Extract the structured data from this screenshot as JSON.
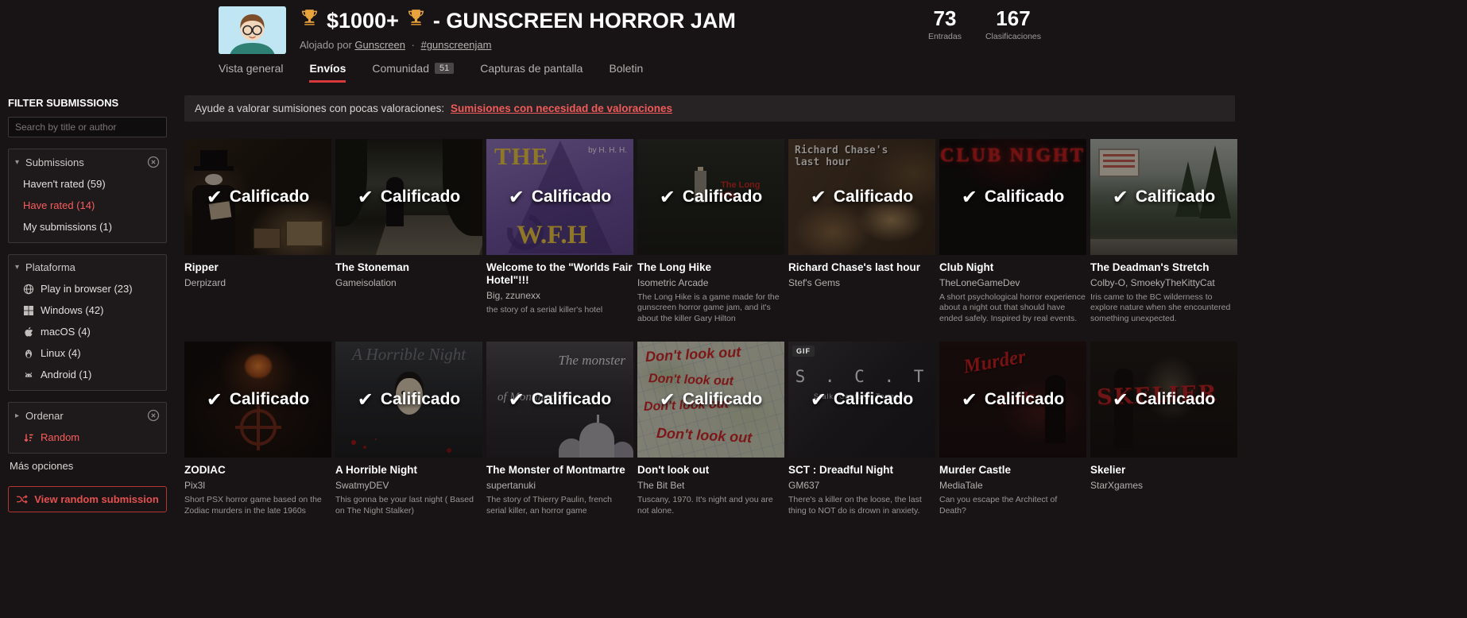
{
  "icons": {
    "check": "✔",
    "caret_down": "▾",
    "caret_right": "▸"
  },
  "header": {
    "prize": "$1000+",
    "title_rest": "- GUNSCREEN HORROR JAM",
    "hosted_prefix": "Alojado por",
    "host": "Gunscreen",
    "dot": "·",
    "hashtag": "#gunscreenjam",
    "stats": [
      {
        "value": "73",
        "label": "Entradas"
      },
      {
        "value": "167",
        "label": "Clasificaciones"
      }
    ]
  },
  "tabs": [
    {
      "label": "Vista general"
    },
    {
      "label": "Envíos",
      "active": true
    },
    {
      "label": "Comunidad",
      "badge": "51"
    },
    {
      "label": "Capturas de pantalla"
    },
    {
      "label": "Boletin"
    }
  ],
  "sidebar": {
    "title": "FILTER SUBMISSIONS",
    "search_placeholder": "Search by title or author",
    "sections": [
      {
        "label": "Submissions",
        "closable": true,
        "items": [
          {
            "label": "Haven't rated (59)"
          },
          {
            "label": "Have rated (14)",
            "active": true
          },
          {
            "label": "My submissions (1)"
          }
        ]
      },
      {
        "label": "Plataforma",
        "items": [
          {
            "icon": "globe",
            "label": "Play in browser (23)"
          },
          {
            "icon": "windows",
            "label": "Windows (42)"
          },
          {
            "icon": "apple",
            "label": "macOS (4)"
          },
          {
            "icon": "linux",
            "label": "Linux (4)"
          },
          {
            "icon": "android",
            "label": "Android (1)"
          }
        ]
      },
      {
        "label": "Ordenar",
        "closable": true,
        "items": [
          {
            "icon": "sort",
            "label": "Random",
            "active": true
          },
          {
            "label": "Más opciones"
          }
        ]
      }
    ],
    "random_button_label": "View random submission"
  },
  "notice": {
    "text": "Ayude a valorar sumisiones con pocas valoraciones:",
    "link_label": "Sumisiones con necesidad de valoraciones"
  },
  "rated_label": "Calificado",
  "gif_badge_label": "GIF",
  "cards": [
    {
      "title": "Ripper",
      "author": "Derpizard",
      "desc": "",
      "thumb": "ripper",
      "art": [
        {
          "cls": "rip-coat"
        },
        {
          "cls": "rip-face"
        },
        {
          "cls": "rip-hat"
        },
        {
          "cls": "rip-paper"
        },
        {
          "cls": "rip-panel"
        },
        {
          "cls": "rip-panel2"
        }
      ]
    },
    {
      "title": "The Stoneman",
      "author": "Gameisolation",
      "desc": "",
      "thumb": "stoneman",
      "art": [
        {
          "cls": "st-road"
        },
        {
          "cls": "st-tree-l"
        },
        {
          "cls": "st-tree-r"
        },
        {
          "cls": "st-fig"
        }
      ]
    },
    {
      "title": "Welcome to the \"Worlds Fair Hotel\"!!!",
      "author": "Big, zzunexx",
      "desc": "the story of a serial killer's hotel",
      "thumb": "wfh",
      "art": [
        {
          "cls": "wfh-tri"
        },
        {
          "cls": "wfh-swirl"
        },
        {
          "cls": "wfh-the",
          "text": "THE"
        },
        {
          "cls": "wfh-by",
          "text": "by H. H. H."
        },
        {
          "cls": "wfh-main",
          "text": "W.F.H"
        }
      ]
    },
    {
      "title": "The Long Hike",
      "author": "Isometric Arcade",
      "desc": "The Long Hike is a game made for the gunscreen horror game jam, and it's about the killer Gary Hilton",
      "thumb": "longhike",
      "art": [
        {
          "cls": "lh-fig"
        },
        {
          "cls": "lh-red",
          "text": "The Long Hike"
        }
      ]
    },
    {
      "title": "Richard Chase's last hour",
      "author": "Stef's Gems",
      "desc": "",
      "thumb": "richard",
      "art": [
        {
          "cls": "rc-text",
          "text": "Richard Chase's last hour"
        }
      ]
    },
    {
      "title": "Club Night",
      "author": "TheLoneGameDev",
      "desc": "A short psychological horror experience about a night out that should have ended safely. Inspired by real events.",
      "thumb": "clubnight",
      "art": [
        {
          "cls": "cn-text",
          "text": "CLUB NIGHT"
        }
      ]
    },
    {
      "title": "The Deadman's Stretch",
      "author": "Colby-O, SmoekyTheKittyCat",
      "desc": "Iris came to the BC wilderness to explore nature when she encountered something unexpected.",
      "thumb": "deadman",
      "art": [
        {
          "cls": "dm-tree1"
        },
        {
          "cls": "dm-tree2"
        },
        {
          "cls": "dm-sign"
        },
        {
          "cls": "dm-road"
        }
      ]
    },
    {
      "title": "ZODIAC",
      "author": "Pix3l",
      "desc": "Short PSX horror game based on the Zodiac murders in the late 1960s",
      "thumb": "zodiac",
      "art": [
        {
          "cls": "z-face"
        },
        {
          "cls": "z-symbol"
        }
      ]
    },
    {
      "title": "A Horrible Night",
      "author": "SwatmyDEV",
      "desc": "This gonna be your last night ( Based on The Night Stalker)",
      "thumb": "horrible",
      "art": [
        {
          "cls": "hn-title",
          "text": "A Horrible Night"
        },
        {
          "cls": "hn-face"
        },
        {
          "cls": "hn-blood"
        }
      ]
    },
    {
      "title": "The Monster of Montmartre",
      "author": "supertanuki",
      "desc": "The story of Thierry Paulin, french serial killer, an horror game",
      "thumb": "montmartre",
      "art": [
        {
          "cls": "mm-dome"
        },
        {
          "cls": "mm-text",
          "text": "The monster"
        },
        {
          "cls": "mm-text2",
          "text": "of Montmartre"
        }
      ]
    },
    {
      "title": "Don't look out",
      "author": "The Bit Bet",
      "desc": "Tuscany, 1970. It's night and you are not alone.",
      "thumb": "dontlook",
      "art": [
        {
          "cls": "dl-line dl-1",
          "text": "Don't look out"
        },
        {
          "cls": "dl-line dl-2",
          "text": "Don't look out"
        },
        {
          "cls": "dl-line dl-3",
          "text": "Don't look out"
        },
        {
          "cls": "dl-line dl-4",
          "text": "Don't look out"
        }
      ]
    },
    {
      "title": "SCT : Dreadful Night",
      "author": "GM637",
      "desc": "There's a killer on the loose, the last thing to NOT do is drown in anxiety.",
      "thumb": "sct",
      "gif": true,
      "art": [
        {
          "cls": "sct-title",
          "text": "S . C . T"
        },
        {
          "cls": "sct-sub",
          "text": "Stalk. Capture. Torment."
        }
      ]
    },
    {
      "title": "Murder Castle",
      "author": "MediaTale",
      "desc": "Can you escape the Architect of Death?",
      "thumb": "murder",
      "art": [
        {
          "cls": "mc-fig"
        },
        {
          "cls": "mc-text",
          "text": "Murder"
        },
        {
          "cls": "mc-text2",
          "text": "Castle"
        }
      ]
    },
    {
      "title": "Skelier",
      "author": "StarXgames",
      "desc": "",
      "thumb": "skelier",
      "art": [
        {
          "cls": "sk-fig"
        },
        {
          "cls": "sk-text",
          "text": "SKELIER"
        }
      ]
    }
  ]
}
